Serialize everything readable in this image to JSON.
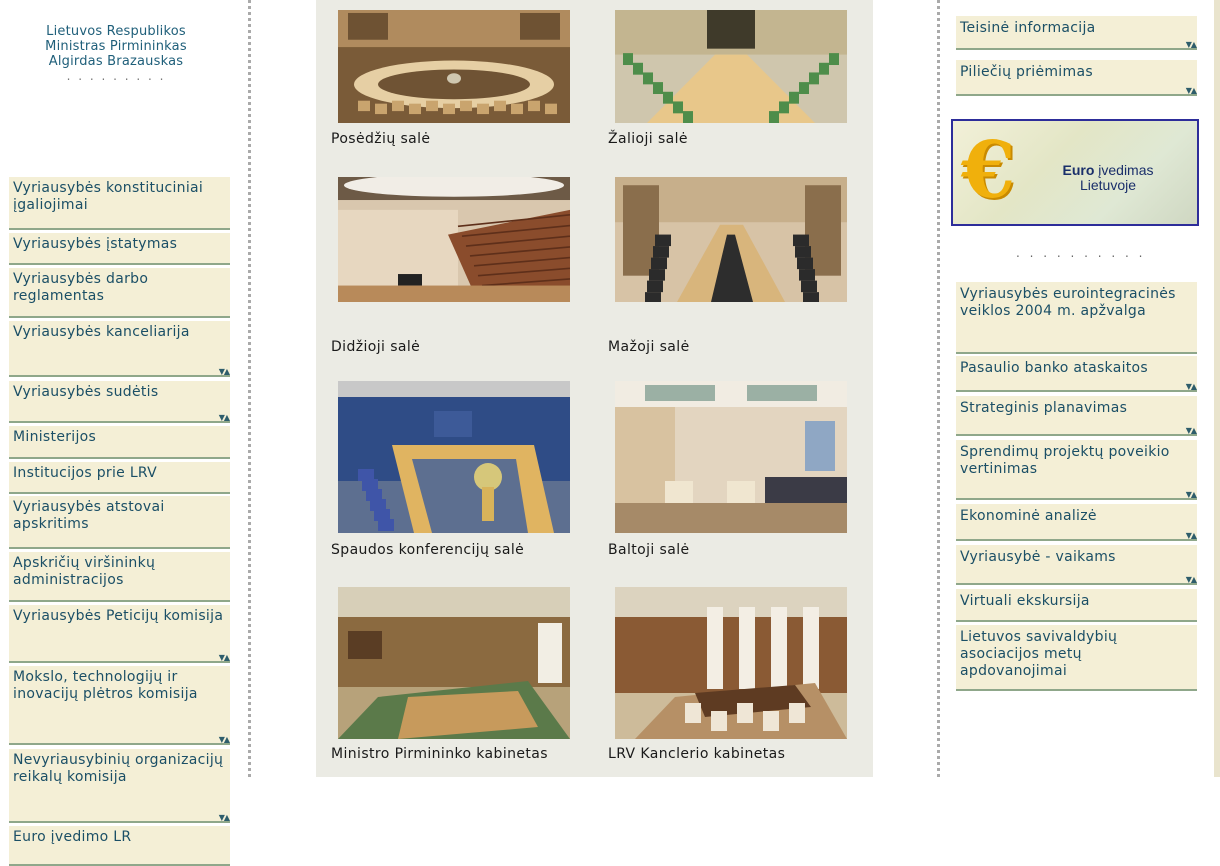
{
  "left": {
    "pm_lines": [
      "Lietuvos Respublikos",
      "Ministras Pirmininkas",
      "Algirdas Brazauskas"
    ],
    "pm_dots": ". . . . . . . . .",
    "menu": [
      {
        "label": "Vyriausybės konstituciniai įgaliojimai",
        "expandable": false
      },
      {
        "label": "Vyriausybės įstatymas",
        "expandable": false
      },
      {
        "label": "Vyriausybės darbo reglamentas",
        "expandable": false
      },
      {
        "label": "Vyriausybės kanceliarija",
        "expandable": true
      },
      {
        "label": "Vyriausybės sudėtis",
        "expandable": true
      },
      {
        "label": "Ministerijos",
        "expandable": false
      },
      {
        "label": "Institucijos prie LRV",
        "expandable": false
      },
      {
        "label": "Vyriausybės atstovai apskritims",
        "expandable": false
      },
      {
        "label": "Apskričių viršininkų administracijos",
        "expandable": false
      },
      {
        "label": "Vyriausybės Peticijų komisija",
        "expandable": true
      },
      {
        "label": "Mokslo, technologijų ir inovacijų plėtros komisija",
        "expandable": true
      },
      {
        "label": "Nevyriausybinių organizacijų reikalų komisija",
        "expandable": true
      },
      {
        "label": "Euro įvedimo LR",
        "expandable": false
      }
    ]
  },
  "gallery": [
    {
      "caption": "Posėdžių salė",
      "scene": "round-table"
    },
    {
      "caption": "Žalioji salė",
      "scene": "long-table-green"
    },
    {
      "caption": "Didžioji salė",
      "scene": "auditorium"
    },
    {
      "caption": "Mažoji salė",
      "scene": "oval-table"
    },
    {
      "caption": "Spaudos konferencijų salė",
      "scene": "press-room"
    },
    {
      "caption": "Baltoji salė",
      "scene": "lounge"
    },
    {
      "caption": "Ministro Pirmininko kabinetas",
      "scene": "cabinet-pm"
    },
    {
      "caption": "LRV Kanclerio kabinetas",
      "scene": "cabinet-chancellor"
    }
  ],
  "right": {
    "top_items": [
      {
        "label": "Teisinė informacija",
        "expandable": true
      },
      {
        "label": "Piliečių priėmimas",
        "expandable": true
      }
    ],
    "banner": {
      "bold": "Euro",
      "rest": "įvedimas",
      "line2": "Lietuvoje",
      "symbol": "€"
    },
    "dots": ". . . . . . . . . .",
    "items": [
      {
        "label": "Vyriausybės eurointegracinės veiklos 2004 m. apžvalga",
        "expandable": false
      },
      {
        "label": "Pasaulio banko ataskaitos",
        "expandable": true
      },
      {
        "label": "Strateginis planavimas",
        "expandable": true
      },
      {
        "label": "Sprendimų projektų poveikio vertinimas",
        "expandable": true
      },
      {
        "label": "Ekonominė analizė",
        "expandable": true
      },
      {
        "label": "Vyriausybė - vaikams",
        "expandable": true
      },
      {
        "label": "Virtuali ekskursija",
        "expandable": false
      },
      {
        "label": "Lietuvos savivaldybių asociacijos metų apdovanojimai",
        "expandable": false
      }
    ]
  },
  "colors": {
    "menu_bg": "#f4efd6",
    "menu_text": "#1b4f66",
    "menu_border": "#8fa78a",
    "gallery_bg": "#ebebe4"
  }
}
